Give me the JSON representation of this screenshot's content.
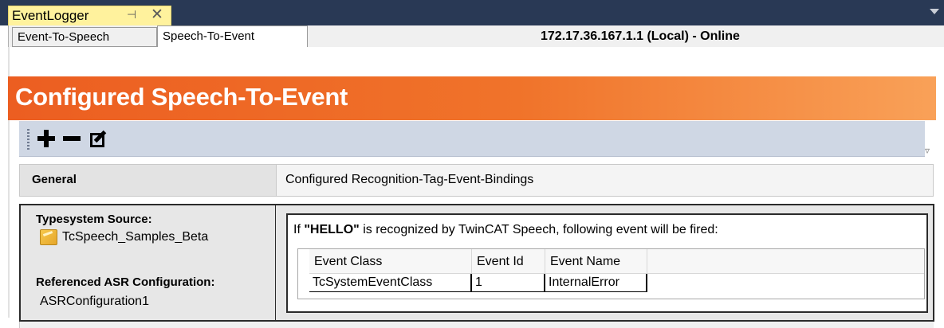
{
  "window": {
    "doc_tab_title": "EventLogger",
    "pin_glyph": "⊣",
    "close_glyph": "✕"
  },
  "tabs": [
    {
      "label": "Event-To-Speech"
    },
    {
      "label": "Speech-To-Event"
    }
  ],
  "status": "172.17.36.167.1.1 (Local) - Online",
  "header": {
    "title": "Configured Speech-To-Event"
  },
  "toolbar": {
    "add_icon": "plus-icon",
    "remove_icon": "minus-icon",
    "edit_icon": "edit-icon"
  },
  "grid": {
    "general_label": "General",
    "bindings_label": "Configured Recognition-Tag-Event-Bindings"
  },
  "left_panel": {
    "typesystem_source_label": "Typesystem Source:",
    "typesystem_source_value": "TcSpeech_Samples_Beta",
    "asr_label": "Referenced ASR Configuration:",
    "asr_value": "ASRConfiguration1"
  },
  "binding": {
    "prefix": "If",
    "tag": "\"HELLO\"",
    "suffix": "is recognized by TwinCAT Speech, following event will be fired:",
    "columns": [
      "Event Class",
      "Event Id",
      "Event Name"
    ],
    "rows": [
      [
        "TcSystemEventClass",
        "1",
        "InternalError"
      ]
    ]
  },
  "colors": {
    "header_orange": "#ec5e21",
    "tab_yellow": "#fff29d",
    "titlebar": "#293955"
  }
}
